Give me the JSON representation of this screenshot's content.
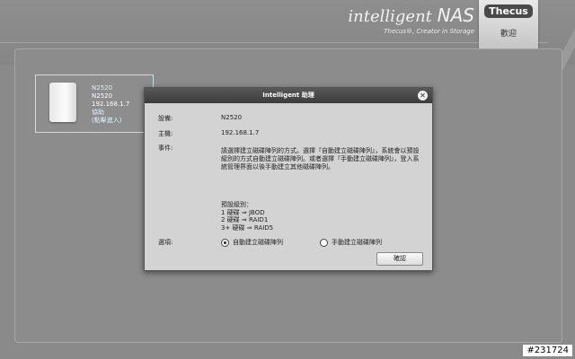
{
  "header": {
    "brand_italic": "intelligent",
    "brand_nas": "NAS",
    "brand_subtitle": "Thecus®, Creator in Storage",
    "logo": "Thecus",
    "welcome": "歡迎"
  },
  "device": {
    "name": "N2520",
    "model": "N2520",
    "ip": "192.168.1.7",
    "status": "協助",
    "link": "(點擊進入)"
  },
  "modal": {
    "title_prefix": "Intelligent",
    "title_suffix": "助理",
    "close": "✕",
    "device_label": "設備:",
    "device_value": "N2520",
    "host_label": "主機:",
    "host_value": "192.168.1.7",
    "event_label": "事件:",
    "event_text": "請選擇建立磁碟陣列的方式。選擇『自動建立磁碟陣列』，系統會以預設級別的方式自動建立磁碟陣列。或者選擇『手動建立磁碟陣列』，登入系統管理界面以後手動建立其他磁碟陣列。",
    "levels_title": "預設級別：",
    "level1": "1 硬碟 ⇒ JBOD",
    "level2": "2 硬碟 ⇒ RAID1",
    "level3": "3+ 硬碟 ⇒ RAID5",
    "option_label": "選項:",
    "option_auto": "自動建立磁碟陣列",
    "option_manual": "手動建立磁碟陣列",
    "confirm": "確認"
  },
  "badge": "#231724"
}
